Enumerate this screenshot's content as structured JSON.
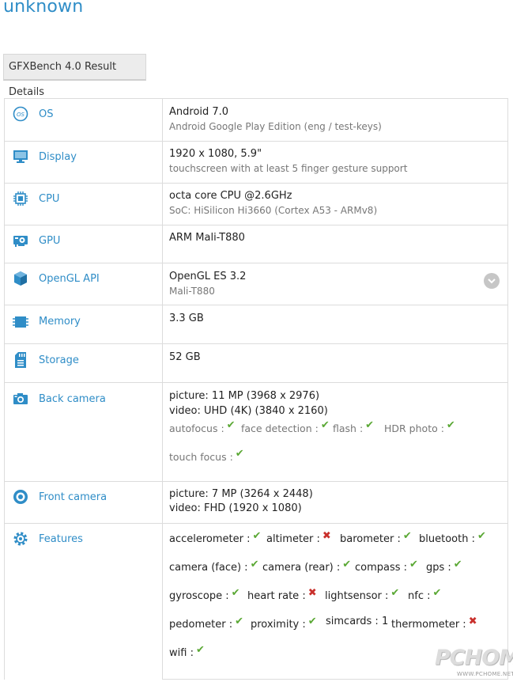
{
  "page": {
    "title": "unknown",
    "tab_label": "GFXBench 4.0 Result Details"
  },
  "colors": {
    "accent": "#2f8dc7",
    "check": "#5aa834",
    "cross": "#c9302c",
    "border": "#dcdcdc"
  },
  "rows": {
    "os": {
      "icon": "os-icon",
      "label": "OS",
      "main": "Android 7.0",
      "sub": "Android Google Play Edition (eng / test-keys)"
    },
    "display": {
      "icon": "display-icon",
      "label": "Display",
      "main": "1920 x 1080, 5.9\"",
      "sub": "touchscreen with at least 5 finger gesture support"
    },
    "cpu": {
      "icon": "cpu-icon",
      "label": "CPU",
      "main": "octa core CPU @2.6GHz",
      "sub": "SoC: HiSilicon Hi3660 (Cortex A53 - ARMv8)"
    },
    "gpu": {
      "icon": "gpu-icon",
      "label": "GPU",
      "main": "ARM Mali-T880"
    },
    "opengl": {
      "icon": "opengl-cube-icon",
      "label": "OpenGL API",
      "main": "OpenGL ES 3.2",
      "sub": "Mali-T880",
      "expand_icon": "chevron-down-icon"
    },
    "memory": {
      "icon": "memory-chip-icon",
      "label": "Memory",
      "main": "3.3 GB"
    },
    "storage": {
      "icon": "sd-card-icon",
      "label": "Storage",
      "main": "52 GB"
    },
    "back_camera": {
      "icon": "camera-icon",
      "label": "Back camera",
      "picture": "picture: 11 MP (3968 x 2976)",
      "video": "video: UHD (4K) (3840 x 2160)",
      "features": {
        "autofocus": {
          "label": "autofocus :",
          "supported": true
        },
        "face_detection": {
          "label": "face detection :",
          "supported": true
        },
        "flash": {
          "label": "flash :",
          "supported": true
        },
        "hdr_photo": {
          "label": "HDR photo :",
          "supported": true
        },
        "touch_focus": {
          "label": "touch focus :",
          "supported": true
        }
      }
    },
    "front_camera": {
      "icon": "front-camera-icon",
      "label": "Front camera",
      "picture": "picture: 7 MP (3264 x 2448)",
      "video": "video: FHD (1920 x 1080)"
    },
    "features": {
      "icon": "gear-icon",
      "label": "Features",
      "items": {
        "accelerometer": {
          "label": "accelerometer :",
          "supported": true
        },
        "altimeter": {
          "label": "altimeter :",
          "supported": false
        },
        "barometer": {
          "label": "barometer :",
          "supported": true
        },
        "bluetooth": {
          "label": "bluetooth :",
          "supported": true
        },
        "camera_face": {
          "label": "camera (face) :",
          "supported": true
        },
        "camera_rear": {
          "label": "camera (rear) :",
          "supported": true
        },
        "compass": {
          "label": "compass :",
          "supported": true
        },
        "gps": {
          "label": "gps :",
          "supported": true
        },
        "gyroscope": {
          "label": "gyroscope :",
          "supported": true
        },
        "heart_rate": {
          "label": "heart rate :",
          "supported": false
        },
        "lightsensor": {
          "label": "lightsensor :",
          "supported": true
        },
        "nfc": {
          "label": "nfc :",
          "supported": true
        },
        "pedometer": {
          "label": "pedometer :",
          "supported": true
        },
        "proximity": {
          "label": "proximity :",
          "supported": true
        },
        "simcards": {
          "label": "simcards :",
          "value": "1"
        },
        "thermometer": {
          "label": "thermometer :",
          "supported": false
        },
        "wifi": {
          "label": "wifi :",
          "supported": true
        }
      }
    }
  },
  "marks": {
    "yes": "✔",
    "no": "✖"
  },
  "watermark": {
    "logo": "PCHOME",
    "site": "WWW.PCHOME.NET"
  }
}
